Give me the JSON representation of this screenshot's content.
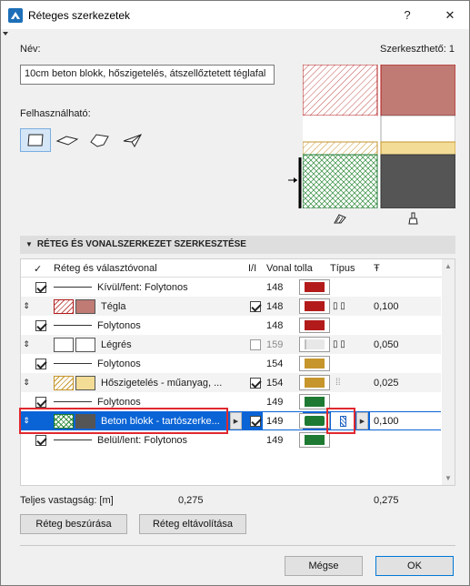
{
  "window": {
    "title": "Réteges szerkezetek",
    "help_label": "?",
    "close_label": "✕"
  },
  "name": {
    "label": "Név:",
    "value": "10cm beton blokk, hőszigetelés, átszellőztetett téglafal",
    "editable_label": "Szerkeszthető: 1"
  },
  "usable": {
    "label": "Felhasználható:",
    "options": [
      "wall-icon",
      "slab-icon",
      "roof-icon",
      "shell-icon"
    ]
  },
  "section": {
    "title": "RÉTEG ÉS VONALSZERKEZET SZERKESZTÉSE"
  },
  "table": {
    "headers": {
      "check": "✓",
      "name": "Réteg és választóvonal",
      "core": "I/I",
      "pen": "Vonal tolla",
      "type": "Típus",
      "thickness": "Ŧ"
    },
    "rows": [
      {
        "kind": "line",
        "checked": true,
        "name": "Kívül/fent: Folytonos",
        "pen": "148",
        "pen_color": "#b31b1b"
      },
      {
        "kind": "skin",
        "name": "Tégla",
        "core": true,
        "pen": "148",
        "pen_color": "#b31b1b",
        "thickness": "0,100",
        "swatch_color": "#c07b74",
        "pattern": "hatch-red"
      },
      {
        "kind": "line",
        "checked": true,
        "name": "Folytonos",
        "pen": "148",
        "pen_color": "#b31b1b"
      },
      {
        "kind": "skin",
        "name": "Légrés",
        "core": false,
        "pen": "159",
        "pen_color": "#c0c0c0",
        "thickness": "0,050",
        "swatch_color": "#ffffff",
        "pattern": "none"
      },
      {
        "kind": "line",
        "checked": true,
        "name": "Folytonos",
        "pen": "154",
        "pen_color": "#c6962c"
      },
      {
        "kind": "skin",
        "name": "Hőszigetelés - műanyag, ...",
        "core": true,
        "pen": "154",
        "pen_color": "#c6962c",
        "thickness": "0,025",
        "swatch_color": "#f3dc96",
        "pattern": "hatch-yellow"
      },
      {
        "kind": "line",
        "checked": true,
        "name": "Folytonos",
        "pen": "149",
        "pen_color": "#1e7a32"
      },
      {
        "kind": "skin",
        "selected": true,
        "name": "Beton blokk - tartószerke...",
        "core": true,
        "pen": "149",
        "pen_color": "#1e7a32",
        "thickness": "0,100",
        "swatch_color": "#555555",
        "pattern": "cross-green"
      },
      {
        "kind": "line",
        "checked": true,
        "name": "Belül/lent: Folytonos",
        "pen": "149",
        "pen_color": "#1e7a32"
      }
    ]
  },
  "totals": {
    "label": "Teljes vastagság: [m]",
    "core_value": "0,275",
    "total_value": "0,275"
  },
  "buttons": {
    "insert": "Réteg beszúrása",
    "remove": "Réteg eltávolítása",
    "cancel": "Mégse",
    "ok": "OK"
  },
  "colors": {
    "selection": "#0a64d6",
    "highlight_frame": "#e0282e",
    "brick": "#c07b74",
    "insulation": "#f3dc96",
    "concrete": "#555555"
  }
}
